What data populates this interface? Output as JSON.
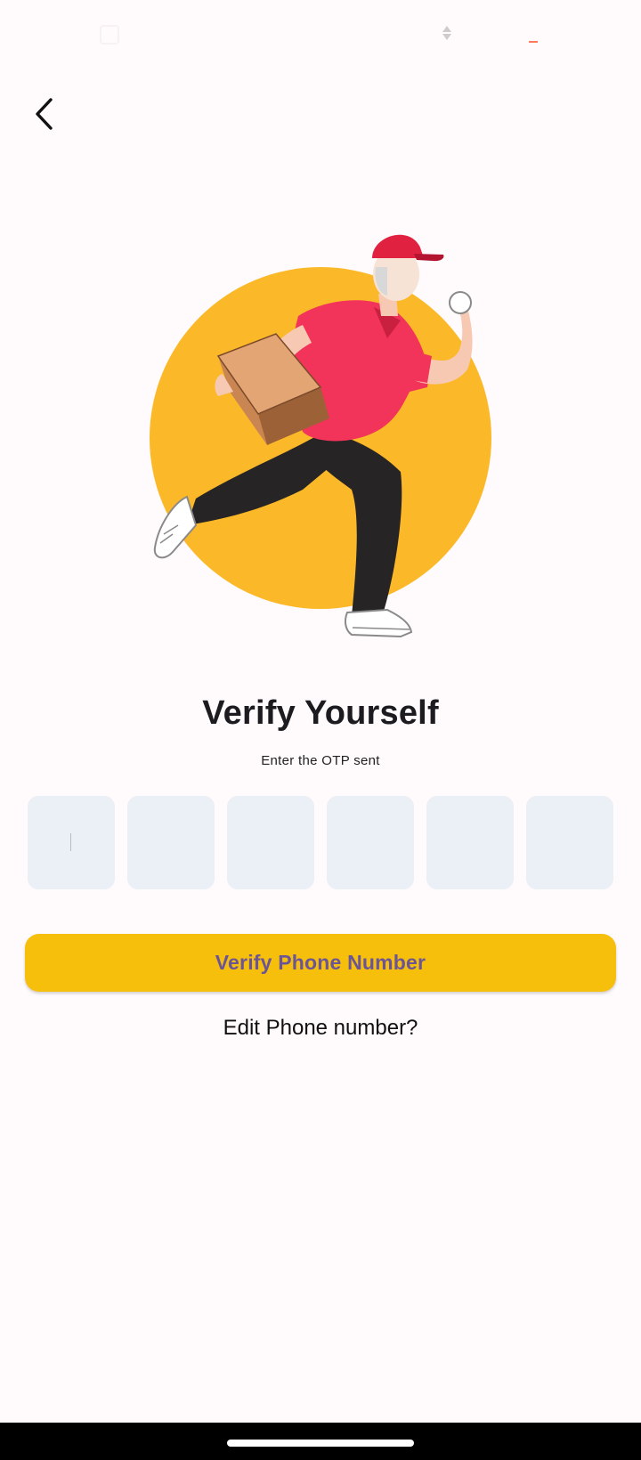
{
  "header": {
    "back_icon": "chevron-left-icon"
  },
  "illustration": {
    "subject": "delivery-man-running-with-box",
    "colors": {
      "circle": "#fbb829",
      "shirt": "#f2335a",
      "pants": "#262424",
      "box": "#e4a574"
    }
  },
  "main": {
    "title": "Verify Yourself",
    "subtitle": "Enter the OTP sent",
    "otp_boxes": [
      {
        "value": "",
        "focused": true
      },
      {
        "value": "",
        "focused": false
      },
      {
        "value": "",
        "focused": false
      },
      {
        "value": "",
        "focused": false
      },
      {
        "value": "",
        "focused": false
      },
      {
        "value": "",
        "focused": false
      }
    ],
    "verify_button_label": "Verify Phone Number",
    "edit_link_label": "Edit Phone number?"
  },
  "colors": {
    "background": "#fffafc",
    "accent": "#f5bf0c",
    "button_text": "#6c5596",
    "otp_box": "#ebeff6"
  }
}
